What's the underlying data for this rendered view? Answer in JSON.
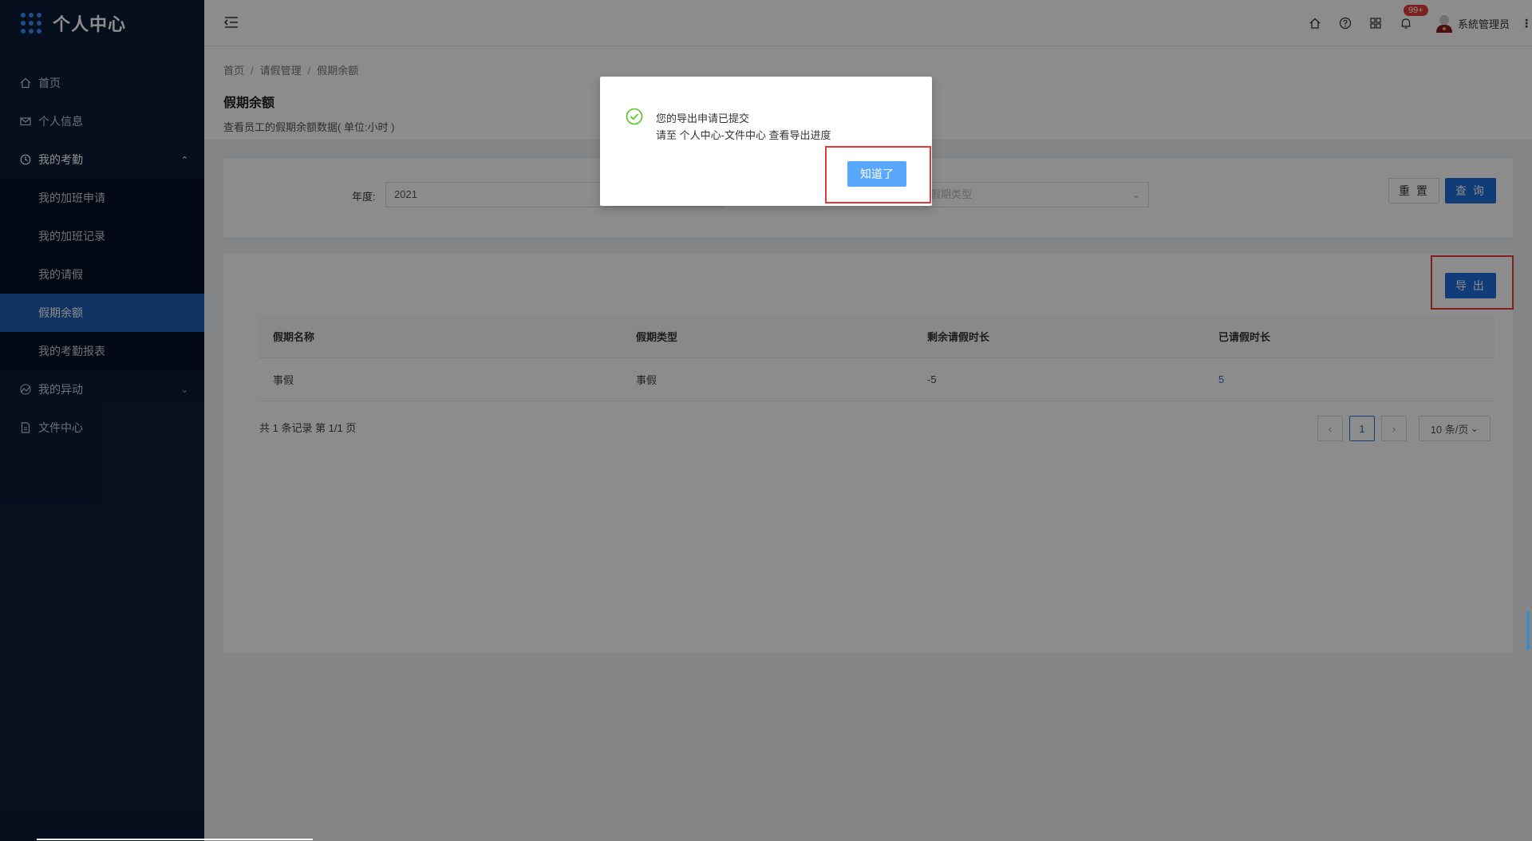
{
  "app": {
    "title": "个人中心"
  },
  "sidebar": {
    "items": [
      {
        "label": "首页",
        "icon": "home-icon"
      },
      {
        "label": "个人信息",
        "icon": "mail-icon"
      },
      {
        "label": "我的考勤",
        "icon": "clock-icon",
        "expanded": true
      },
      {
        "label": "我的异动",
        "icon": "chart-icon",
        "expanded": false
      },
      {
        "label": "文件中心",
        "icon": "file-icon"
      }
    ],
    "submenu": [
      {
        "label": "我的加班申请"
      },
      {
        "label": "我的加班记录"
      },
      {
        "label": "我的请假"
      },
      {
        "label": "假期余额",
        "active": true
      },
      {
        "label": "我的考勤报表"
      }
    ]
  },
  "header": {
    "notification_count": "99+",
    "username": "系統管理员"
  },
  "breadcrumb": [
    "首页",
    "请假管理",
    "假期余额"
  ],
  "page": {
    "title": "假期余额",
    "description": "查看员工的假期余额数据( 单位:小时 )"
  },
  "search": {
    "year_label": "年度:",
    "year_value": "2021",
    "type_placeholder": "假期类型",
    "reset_label": "重 置",
    "query_label": "查 询"
  },
  "table": {
    "export_label": "导 出",
    "columns": [
      "假期名称",
      "假期类型",
      "剩余请假时长",
      "已请假时长"
    ],
    "rows": [
      [
        "事假",
        "事假",
        "-5",
        "5"
      ]
    ],
    "summary": "共 1 条记录 第 1/1 页",
    "current_page": "1",
    "page_size": "10 条/页"
  },
  "dialog": {
    "title": "您的导出申请已提交",
    "content": "请至 个人中心-文件中心 查看导出进度",
    "ok_label": "知道了"
  },
  "colors": {
    "sidebar_bg": "#0c1d35",
    "active_menu": "#1f5eb5",
    "primary": "#1e6fd9",
    "success": "#52c41a",
    "highlight": "#e53935"
  }
}
